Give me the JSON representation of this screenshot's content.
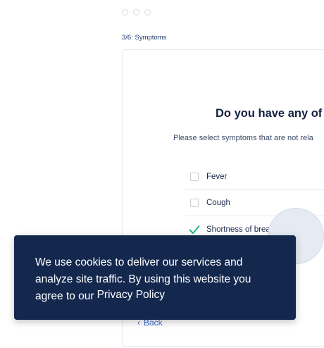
{
  "progress": {
    "step_label": "3/6: Symptoms"
  },
  "question": {
    "title": "Do you have any of",
    "instruction": "Please select symptoms that are not rela"
  },
  "symptoms": [
    {
      "label": "Fever",
      "checked": false
    },
    {
      "label": "Cough",
      "checked": false
    },
    {
      "label": "Shortness of breath",
      "checked": true,
      "has_info": true
    }
  ],
  "navigation": {
    "back_label": "Back",
    "back_icon": "chevron-left-icon"
  },
  "cookie_banner": {
    "text": "We use cookies to deliver our services and analyze site traffic. By using this website you agree to our",
    "link_label": "Privacy Policy"
  },
  "colors": {
    "accent": "#3d6fd1",
    "check": "#1fb58f",
    "banner_bg": "#14284e",
    "title": "#13213f"
  }
}
